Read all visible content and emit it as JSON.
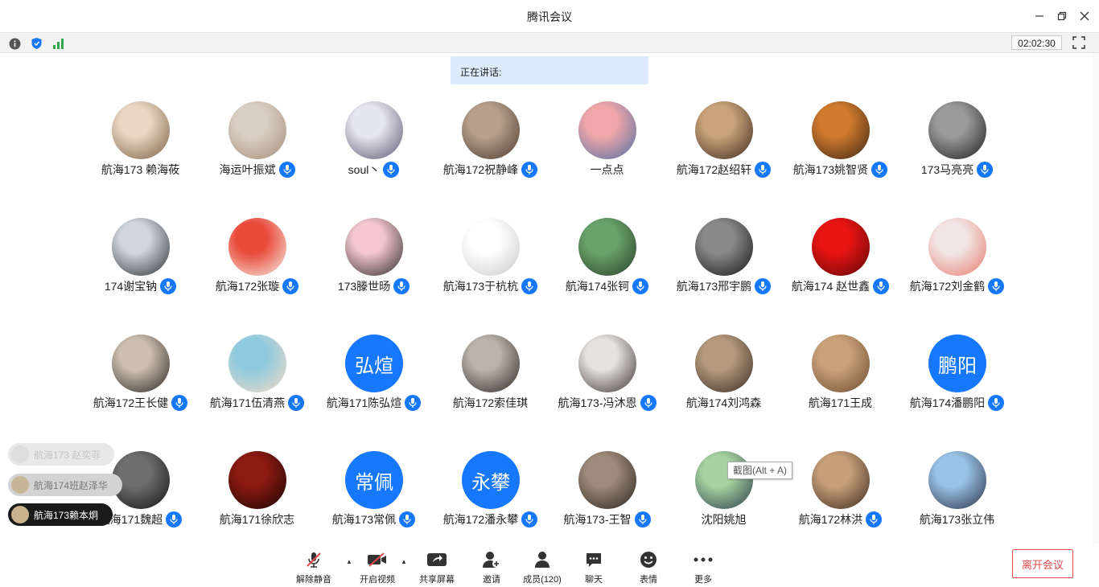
{
  "window": {
    "title": "腾讯会议"
  },
  "status": {
    "timer": "02:02:30"
  },
  "speaking": {
    "label": "正在讲话:"
  },
  "participants": [
    {
      "name": "航海173 赖海莜",
      "mic": false,
      "avatar_colors": [
        "#e9d7c3",
        "#7a5d42"
      ]
    },
    {
      "name": "海运叶振斌",
      "mic": true,
      "avatar_colors": [
        "#d9cfc4",
        "#a58e78"
      ]
    },
    {
      "name": "soul丶",
      "mic": true,
      "avatar_colors": [
        "#e6e6ee",
        "#5b5670"
      ]
    },
    {
      "name": "航海172祝静峰",
      "mic": true,
      "avatar_colors": [
        "#b8a08c",
        "#4a3a2e"
      ]
    },
    {
      "name": "一点点",
      "mic": false,
      "avatar_colors": [
        "#f0a7a9",
        "#4f6ea3"
      ]
    },
    {
      "name": "航海172赵绍轩",
      "mic": true,
      "avatar_colors": [
        "#c9a37a",
        "#3a2a1e"
      ]
    },
    {
      "name": "航海173姚智贤",
      "mic": true,
      "avatar_colors": [
        "#d17b2e",
        "#3a2414"
      ]
    },
    {
      "name": "173马亮亮",
      "mic": true,
      "avatar_colors": [
        "#9a9a9a",
        "#1e1e1e"
      ]
    },
    {
      "name": "174谢宝钠",
      "mic": true,
      "avatar_colors": [
        "#cfd6db",
        "#2b2f33"
      ]
    },
    {
      "name": "航海172张璇",
      "mic": true,
      "avatar_colors": [
        "#e94a3a",
        "#f6f0e8"
      ]
    },
    {
      "name": "173滕世旸",
      "mic": true,
      "avatar_colors": [
        "#f4c7cf",
        "#2a2a2a"
      ]
    },
    {
      "name": "航海173于杭杭",
      "mic": true,
      "avatar_colors": [
        "#ffffff",
        "#c8c8c8"
      ]
    },
    {
      "name": "航海174张钶",
      "mic": true,
      "avatar_colors": [
        "#6aa36a",
        "#2a3e2a"
      ]
    },
    {
      "name": "航海173邢宇鹏",
      "mic": true,
      "avatar_colors": [
        "#8a8a8a",
        "#151515"
      ]
    },
    {
      "name": "航海174 赵世鑫",
      "mic": true,
      "avatar_colors": [
        "#e81414",
        "#5e0505"
      ]
    },
    {
      "name": "航海172刘金鹤",
      "mic": true,
      "avatar_colors": [
        "#f1e6e3",
        "#e7796e"
      ]
    },
    {
      "name": "航海172王长健",
      "mic": true,
      "avatar_colors": [
        "#cdbfb0",
        "#2a2622"
      ]
    },
    {
      "name": "航海171伍清燕",
      "mic": true,
      "avatar_colors": [
        "#8ec9df",
        "#f4dcc4"
      ]
    },
    {
      "name": "航海171陈弘煊",
      "mic": true,
      "text_avatar": "弘煊"
    },
    {
      "name": "航海172索佳琪",
      "mic": false,
      "avatar_colors": [
        "#bdb3aa",
        "#2c2825"
      ]
    },
    {
      "name": "航海173-冯沐恩",
      "mic": true,
      "avatar_colors": [
        "#e6e2e0",
        "#3a3432"
      ]
    },
    {
      "name": "航海174刘鸿森",
      "mic": false,
      "avatar_colors": [
        "#b59a7e",
        "#3a2c22"
      ]
    },
    {
      "name": "航海171王成",
      "mic": false,
      "avatar_colors": [
        "#c9a27a",
        "#6b4a30"
      ]
    },
    {
      "name": "航海174潘鹏阳",
      "mic": true,
      "text_avatar": "鹏阳"
    },
    {
      "name": "航海171魏超",
      "mic": true,
      "avatar_colors": [
        "#6e6e6e",
        "#121212"
      ]
    },
    {
      "name": "航海171徐欣志",
      "mic": false,
      "avatar_colors": [
        "#8a1a12",
        "#1a0403"
      ]
    },
    {
      "name": "航海173常佩",
      "mic": true,
      "text_avatar": "常佩"
    },
    {
      "name": "航海172潘永攀",
      "mic": true,
      "text_avatar": "永攀"
    },
    {
      "name": "航海173-王智",
      "mic": true,
      "avatar_colors": [
        "#9c8a7a",
        "#2a221c"
      ]
    },
    {
      "name": "沈阳姚旭",
      "mic": false,
      "avatar_colors": [
        "#a7d3a0",
        "#2a3a48"
      ]
    },
    {
      "name": "航海172林洪",
      "mic": true,
      "avatar_colors": [
        "#c7a07a",
        "#3a2a1e"
      ]
    },
    {
      "name": "航海173张立伟",
      "mic": false,
      "avatar_colors": [
        "#9ac3e6",
        "#2a3044"
      ]
    }
  ],
  "bubbles": [
    {
      "name": "航海173 赵奕菲",
      "style": "faded"
    },
    {
      "name": "航海174班赵泽华",
      "style": "gray"
    },
    {
      "name": "航海173赖本炯",
      "style": "dark"
    }
  ],
  "tooltip": {
    "text": "截图(Alt + A)"
  },
  "toolbar": {
    "unmute": "解除静音",
    "video": "开启视频",
    "share": "共享屏幕",
    "invite": "邀请",
    "members": "成员(120)",
    "chat": "聊天",
    "emoji": "表情",
    "more": "更多",
    "leave": "离开会议"
  },
  "colors": {
    "accent": "#1677ff",
    "leave": "#e34c4c",
    "speaking_bg": "#dceafb"
  }
}
